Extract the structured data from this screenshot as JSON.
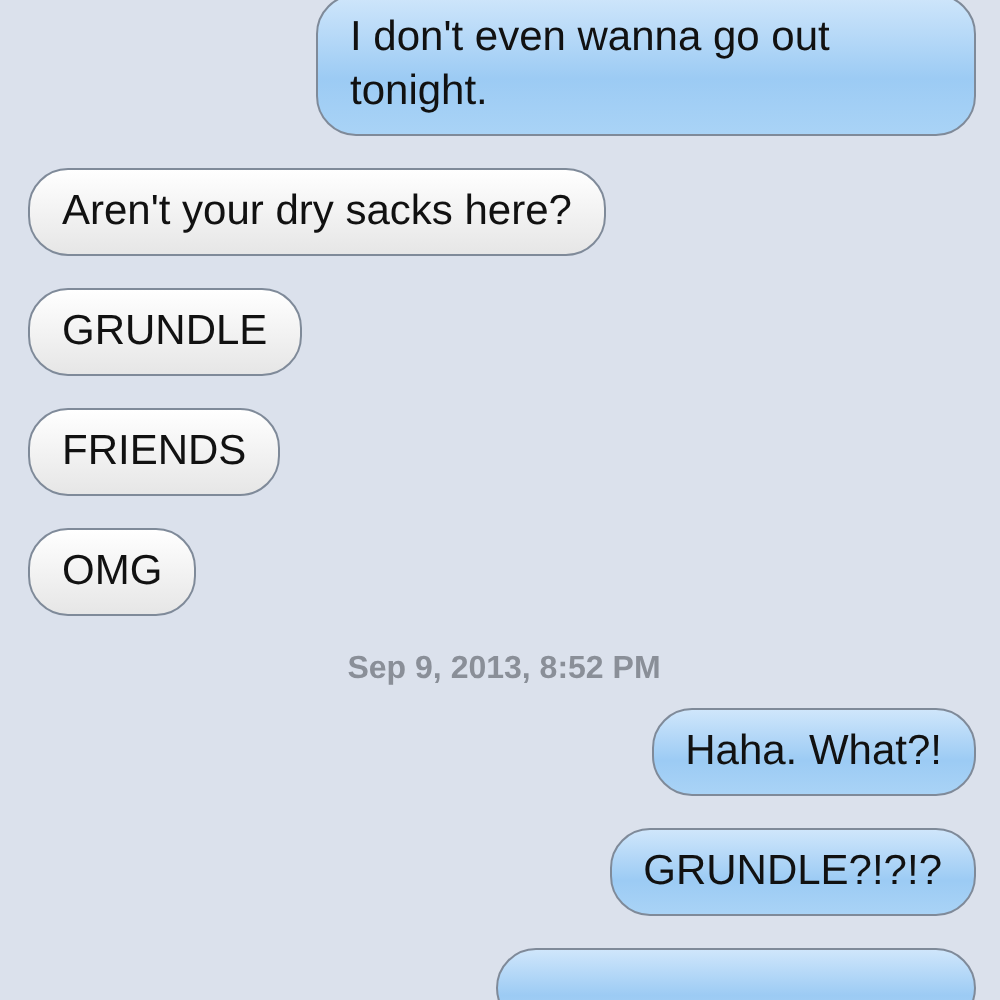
{
  "messages": [
    {
      "kind": "sent",
      "text": "I don't even wanna go out tonight."
    },
    {
      "kind": "received",
      "text": "Aren't your dry sacks here?"
    },
    {
      "kind": "received",
      "text": "GRUNDLE"
    },
    {
      "kind": "received",
      "text": "FRIENDS"
    },
    {
      "kind": "received",
      "text": "OMG"
    },
    {
      "kind": "timestamp",
      "text": "Sep 9, 2013, 8:52 PM"
    },
    {
      "kind": "sent",
      "text": "Haha. What?!"
    },
    {
      "kind": "sent",
      "text": "GRUNDLE?!?!?"
    },
    {
      "kind": "sent_cut"
    }
  ]
}
